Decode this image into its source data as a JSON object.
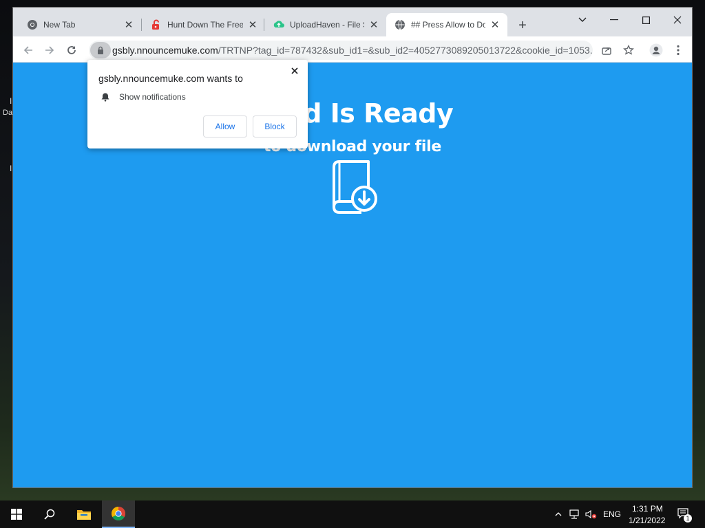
{
  "desktop": {
    "glyph_top": "I",
    "glyph_da": "Da",
    "glyph_bottom": "I"
  },
  "tabs": [
    {
      "title": "New Tab",
      "icon": "chrome-icon",
      "active": false
    },
    {
      "title": "Hunt Down The Freel",
      "icon": "unlock-icon",
      "active": false
    },
    {
      "title": "UploadHaven - File S",
      "icon": "uploadhaven-icon",
      "active": false
    },
    {
      "title": "## Press Allow to Do",
      "icon": "globe-icon",
      "active": true
    }
  ],
  "window_controls": {
    "dropdown": "⌄",
    "minimize": "—",
    "maximize": "☐",
    "close": "✕"
  },
  "address_bar": {
    "host": "gsbly.nnouncemuke.com",
    "path": "/TRTNP?tag_id=787432&sub_id1=&sub_id2=4052773089205013722&cookie_id=1053..."
  },
  "page": {
    "headline": "Load Is Ready",
    "subline": "to download your file",
    "background": "#1e9bf0"
  },
  "permission_popup": {
    "title": "gsbly.nnouncemuke.com wants to",
    "permission": "Show notifications",
    "allow_label": "Allow",
    "block_label": "Block"
  },
  "taskbar": {
    "language": "ENG",
    "time": "1:31 PM",
    "date": "1/21/2022",
    "notification_count": "1"
  }
}
